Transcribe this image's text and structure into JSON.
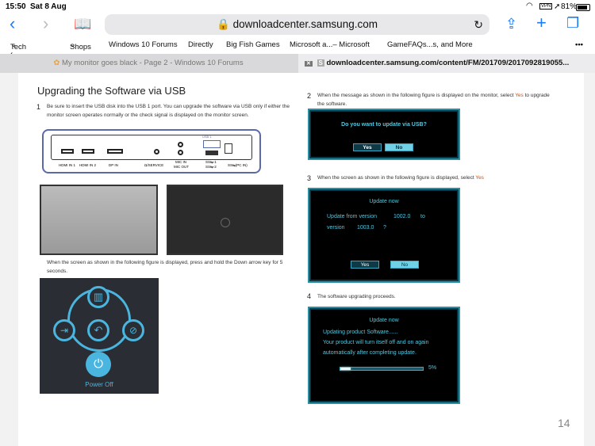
{
  "status": {
    "time": "15:50",
    "date": "Sat 8 Aug",
    "vpn": "VPN",
    "battery": "81%"
  },
  "browser": {
    "url": "downloadcenter.samsung.com",
    "bookmarks": [
      "Tech forums",
      "Shops",
      "Windows 10 Forums",
      "Directly",
      "Big Fish Games",
      "Microsoft a...– Microsoft",
      "GameFAQs...s, and More"
    ],
    "more": "•••",
    "tabs": [
      {
        "title": "My monitor goes black - Page 2 - Windows 10 Forums"
      },
      {
        "title": "downloadcenter.samsung.com/content/FM/201709/2017092819055...",
        "favicon": "S"
      }
    ]
  },
  "doc": {
    "title": "Upgrading the Software via USB",
    "step1_num": "1",
    "step1": "Be sure to insert the USB disk into the USB 1 port. You can upgrade the software via USB only if either the monitor screen operates normally or the check signal is displayed on the monitor screen.",
    "ports": {
      "hdmi1": "HDMI IN 1",
      "hdmi2": "HDMI IN 2",
      "dp": "DP IN",
      "service": "Ω/SERVICE",
      "mic_in": "MIC IN",
      "mic_out": "MIC OUT",
      "usb_label": "USB 1",
      "usb1": "SS⇆-1",
      "usb2": "SS⇆-2",
      "pcin": "SS⇆(PC IN)"
    },
    "step_down": "When the screen as shown in the following figure is displayed, press and hold the Down arrow key for 5 seconds.",
    "power_off": "Power Off",
    "step2_num": "2",
    "step2_a": "When the message as shown in the following figure is displayed on the monitor, select ",
    "step2_yes": "Yes",
    "step2_b": " to upgrade the software.",
    "dlg1": {
      "text": "Do you want to update via USB?",
      "yes": "Yes",
      "no": "No"
    },
    "step3_num": "3",
    "step3_a": "When the screen as shown in the following figure is displayed, select ",
    "step3_yes": "Yes",
    "dlg2": {
      "title": "Update now",
      "line1": "Update  from  version",
      "from": "1002.0",
      "to": "to",
      "line2": "version",
      "version": "1003.0",
      "q": "?",
      "yes": "Yes",
      "no": "No"
    },
    "step4_num": "4",
    "step4": "The software upgrading proceeds.",
    "dlg3": {
      "title": "Update now",
      "line1": "Updating  product  Software......",
      "line2": "Your  product  will  turn  itself  off  and  on  again",
      "line3": "automatically  after  completing  update.",
      "progress": 5,
      "progress_label": "5%"
    },
    "page_number": "14"
  }
}
